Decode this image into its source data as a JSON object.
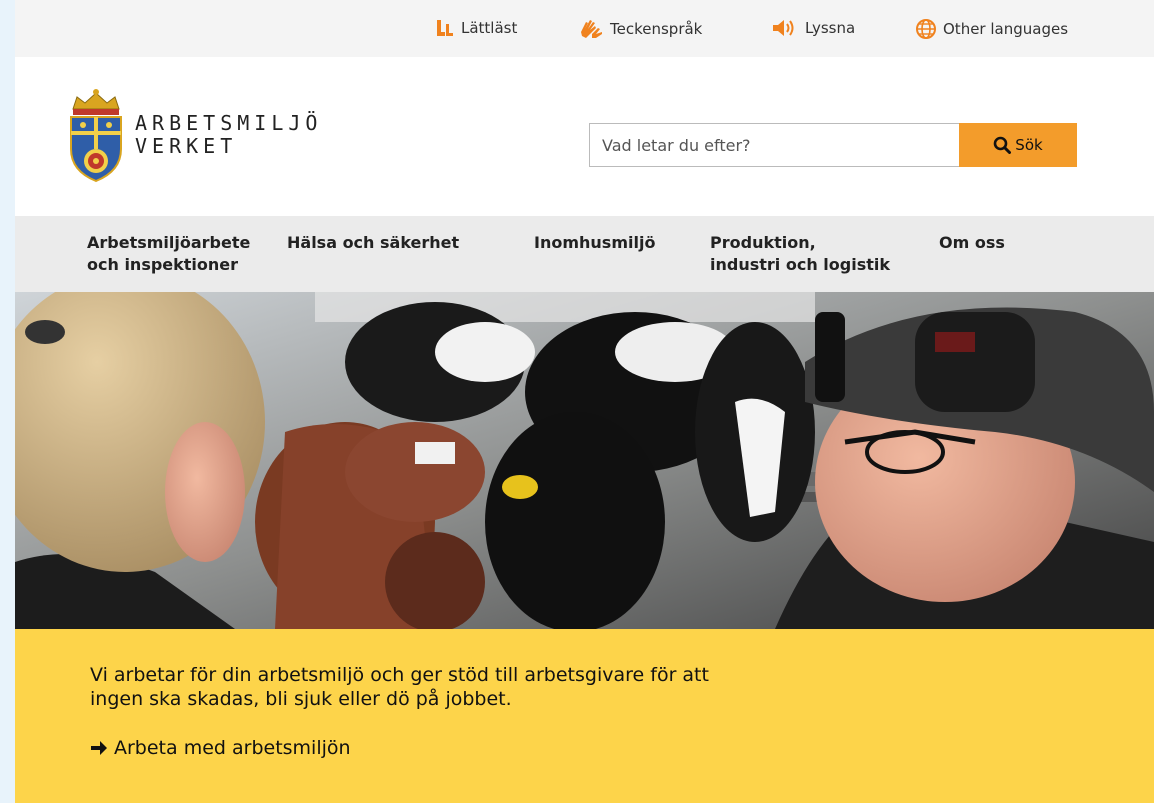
{
  "utility": {
    "easy_read": "Lättläst",
    "sign_language": "Teckenspråk",
    "listen": "Lyssna",
    "other_languages": "Other languages"
  },
  "logo": {
    "line1": "ARBETSMILJÖ",
    "line2": "VERKET"
  },
  "search": {
    "placeholder": "Vad letar du efter?",
    "button_label": "Sök"
  },
  "nav": {
    "items": [
      {
        "label_line1": "Arbetsmiljöarbete",
        "label_line2": "och inspektioner"
      },
      {
        "label_line1": "Hälsa och säkerhet",
        "label_line2": ""
      },
      {
        "label_line1": "Inomhusmiljö",
        "label_line2": ""
      },
      {
        "label_line1": "Produktion,",
        "label_line2": "industri och logistik"
      },
      {
        "label_line1": "Om oss",
        "label_line2": ""
      }
    ]
  },
  "banner": {
    "text": "Vi arbetar för din arbetsmiljö och ger stöd till arbetsgivare för att ingen ska skadas, bli sjuk eller dö på jobbet.",
    "link_label": "Arbeta med arbetsmiljön"
  },
  "colors": {
    "accent_orange": "#f39c2b",
    "banner_yellow": "#fdd44a",
    "nav_gray": "#ebebeb",
    "utility_gray": "#f4f4f4"
  },
  "icons": {
    "easy_read": "easy-read-icon",
    "sign_language": "sign-language-icon",
    "listen": "speaker-icon",
    "other_languages": "globe-icon",
    "search": "search-icon",
    "link": "arrow-right-icon"
  }
}
